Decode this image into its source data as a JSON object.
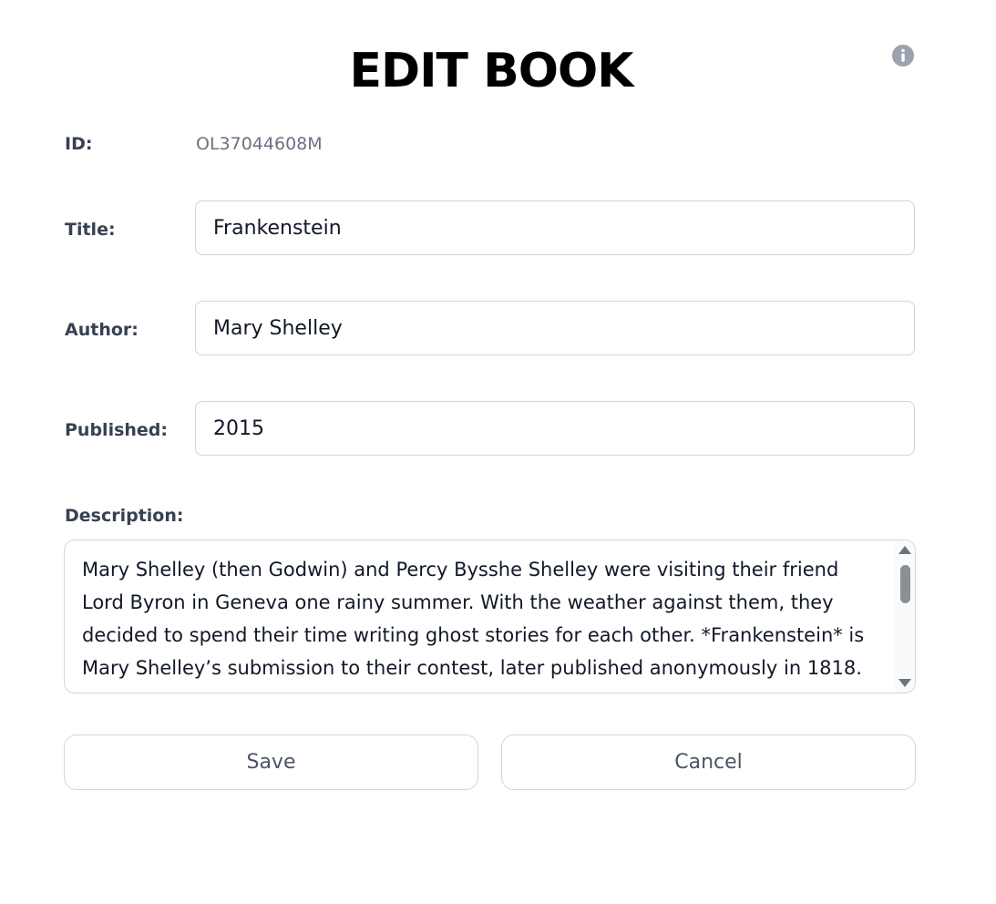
{
  "header": {
    "title": "EDIT BOOK",
    "info_icon": "info-icon"
  },
  "form": {
    "id_label": "ID:",
    "id_value": "OL37044608M",
    "title_label": "Title:",
    "title_value": "Frankenstein",
    "author_label": "Author:",
    "author_value": "Mary Shelley",
    "published_label": "Published:",
    "published_value": "2015",
    "description_label": "Description:",
    "description_value": "Mary Shelley (then Godwin) and Percy Bysshe Shelley were visiting their friend Lord Byron in Geneva one rainy summer. With the weather against them, they decided to spend their time writing ghost stories for each other. *Frankenstein* is Mary Shelley’s submission to their contest, later published anonymously in 1818."
  },
  "actions": {
    "save_label": "Save",
    "cancel_label": "Cancel"
  },
  "colors": {
    "border": "#d1d5db",
    "muted_text": "#6b7280",
    "label_text": "#374151",
    "icon": "#9ca3af"
  }
}
